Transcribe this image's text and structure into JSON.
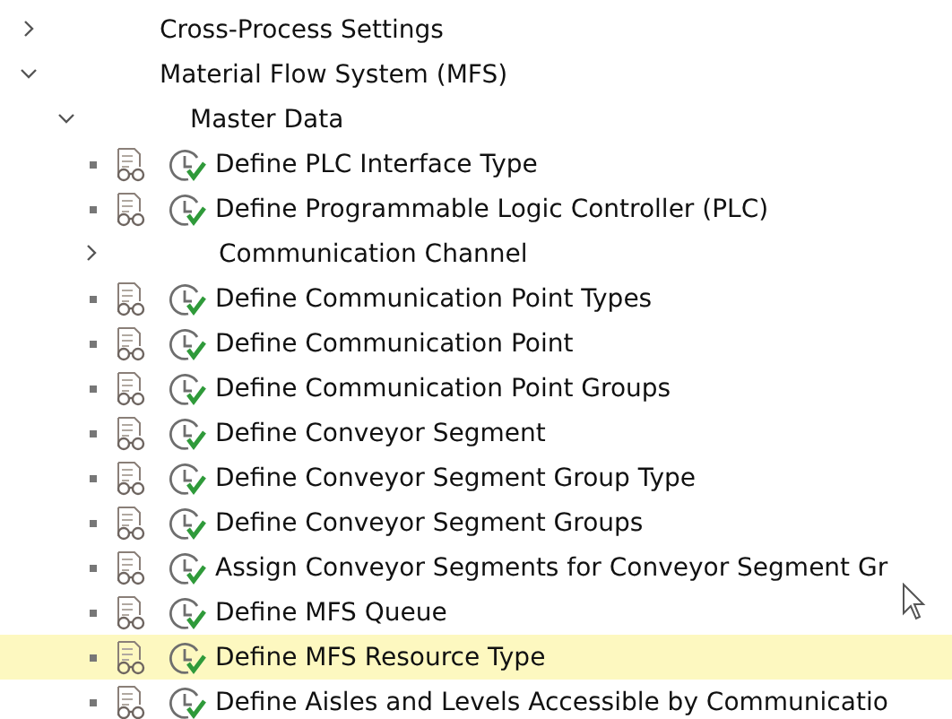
{
  "tree": [
    {
      "label": "Cross-Process Settings",
      "expanded": false
    },
    {
      "label": "Material Flow System (MFS)",
      "expanded": true,
      "children": [
        {
          "label": "Master Data",
          "expanded": true,
          "children": [
            {
              "kind": "activity",
              "label": "Define PLC Interface Type",
              "selected": false
            },
            {
              "kind": "activity",
              "label": "Define Programmable Logic Controller (PLC)",
              "selected": false
            },
            {
              "kind": "folder",
              "label": "Communication Channel",
              "expanded": false
            },
            {
              "kind": "activity",
              "label": "Define Communication Point Types",
              "selected": false
            },
            {
              "kind": "activity",
              "label": "Define Communication Point",
              "selected": false
            },
            {
              "kind": "activity",
              "label": "Define Communication Point Groups",
              "selected": false
            },
            {
              "kind": "activity",
              "label": "Define Conveyor Segment",
              "selected": false
            },
            {
              "kind": "activity",
              "label": "Define Conveyor Segment Group Type",
              "selected": false
            },
            {
              "kind": "activity",
              "label": "Define Conveyor Segment Groups",
              "selected": false
            },
            {
              "kind": "activity",
              "label": "Assign Conveyor Segments for Conveyor Segment Gr",
              "selected": false
            },
            {
              "kind": "activity",
              "label": "Define MFS Queue",
              "selected": false
            },
            {
              "kind": "activity",
              "label": "Define MFS Resource Type",
              "selected": true
            },
            {
              "kind": "activity",
              "label": "Define Aisles and Levels Accessible by Communicatio",
              "selected": false
            }
          ]
        }
      ]
    }
  ]
}
